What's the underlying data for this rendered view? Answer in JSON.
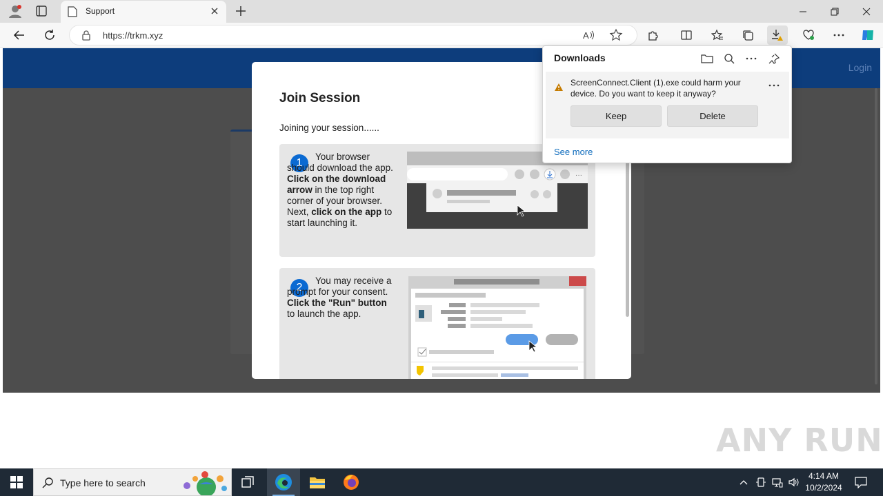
{
  "browser": {
    "tab_title": "Support",
    "url": "https://trkm.xyz"
  },
  "page": {
    "login_link": "Login",
    "modal": {
      "title": "Join Session",
      "subtitle": "Joining your session......",
      "step1": {
        "number": "1",
        "text_a": "Your browser should download the app. ",
        "bold_a": "Click on the download arrow",
        "text_b": " in the top right corner of your browser. Next, ",
        "bold_b": "click on the app",
        "text_c": " to start launching it."
      },
      "step2": {
        "number": "2",
        "text_a": "You may receive a prompt for your consent. ",
        "bold_a": "Click the \"Run\" button",
        "text_b": " to launch the app."
      }
    }
  },
  "downloads": {
    "title": "Downloads",
    "message": "ScreenConnect.Client (1).exe could harm your device. Do you want to keep it anyway?",
    "keep_label": "Keep",
    "delete_label": "Delete",
    "see_more": "See more"
  },
  "watermark": "ANY RUN",
  "taskbar": {
    "search_placeholder": "Type here to search",
    "time": "4:14 AM",
    "date": "10/2/2024"
  },
  "colors": {
    "header_blue": "#0d3d7c",
    "step_circle": "#0b6ad2",
    "link_blue": "#0f6cbd",
    "warning": "#c57b00"
  }
}
